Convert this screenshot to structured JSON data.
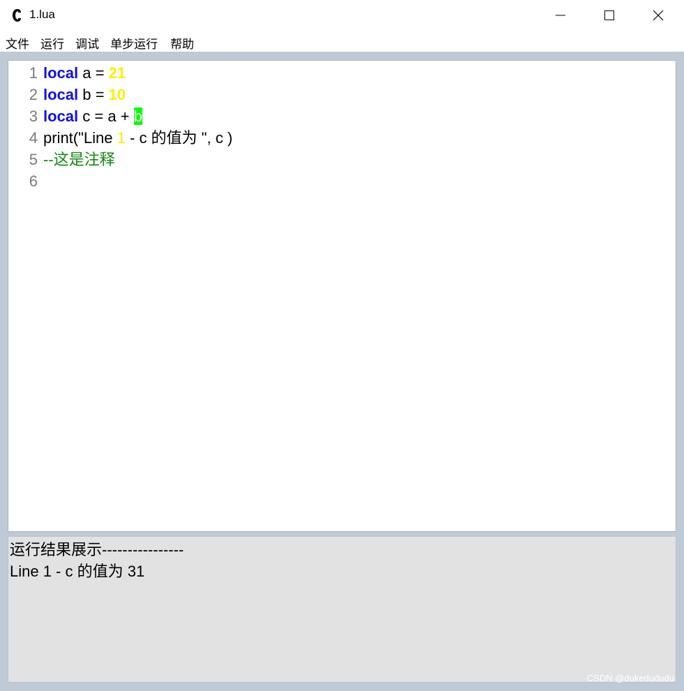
{
  "window": {
    "title": "1.lua",
    "icon": "lua-app-icon",
    "controls": [
      "minimize-icon",
      "maximize-icon",
      "close-icon"
    ]
  },
  "menu": {
    "file": "文件",
    "run": "运行",
    "debug": "调试",
    "step": "单步运行",
    "help": "帮助"
  },
  "editor": {
    "lines": [
      {
        "num": "1",
        "kw": "local",
        "text": " a = ",
        "val": "21"
      },
      {
        "num": "2",
        "kw": "local",
        "text": " b = ",
        "val": "10"
      },
      {
        "num": "3",
        "kw": "local",
        "text": " c = a + ",
        "sel": "b"
      },
      {
        "num": "4",
        "pre": "print(\"Line ",
        "val": "1",
        "post": " - c 的值为 \", c )"
      },
      {
        "num": "5",
        "comment": "--这是注释"
      },
      {
        "num": "6"
      }
    ]
  },
  "output": {
    "lines": [
      "运行结果展示----------------",
      "Line 1 - c 的值为  31"
    ]
  },
  "watermark": "CSDN @dukedududu",
  "colors": {
    "keyword": "#1010e0",
    "number": "#ffee00",
    "comment": "#118811",
    "selection": "#00ff00",
    "output_bg": "#e2e2e2",
    "frame_bg": "#c0cad6"
  }
}
